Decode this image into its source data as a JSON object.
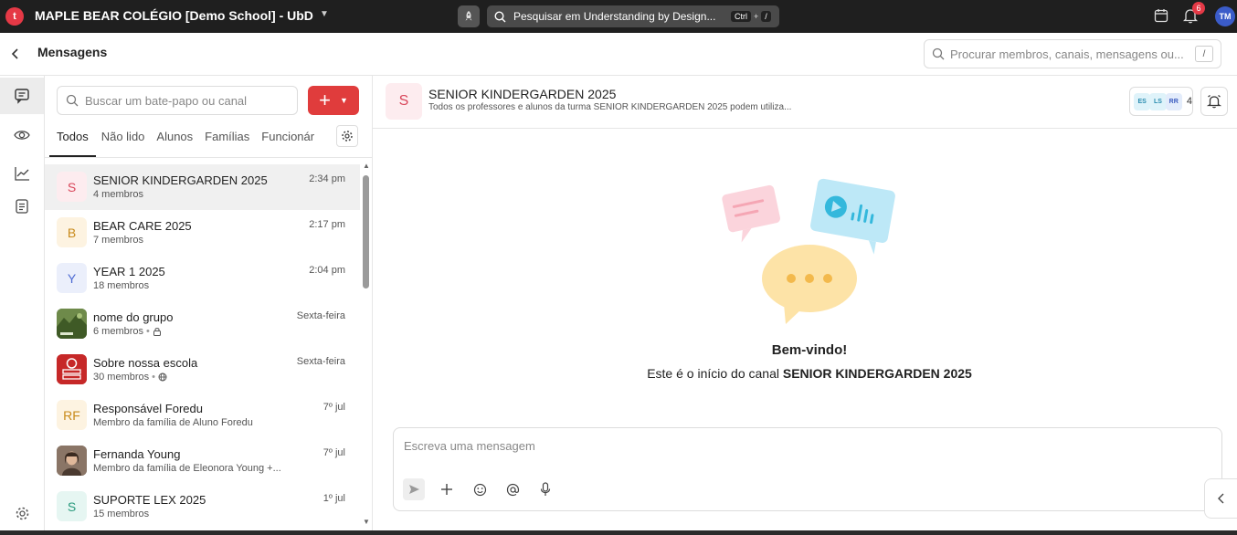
{
  "topbar": {
    "logo_letter": "t",
    "school_name": "MAPLE BEAR COLÉGIO [Demo School] - UbD",
    "search_text": "Pesquisar em Understanding by Design...",
    "shortcut_ctrl": "Ctrl",
    "shortcut_plus": "+",
    "shortcut_slash": "/",
    "notification_count": "6",
    "user_initials": "TM",
    "avatar_color": "#3b5cc9",
    "badge_color": "#e53946"
  },
  "header": {
    "title": "Mensagens",
    "search_placeholder": "Procurar membros, canais, mensagens ou...",
    "search_shortcut": "/"
  },
  "rail": {
    "icons": [
      "chat-icon",
      "eye-icon",
      "analytics-icon",
      "notes-icon",
      "settings-icon"
    ]
  },
  "list": {
    "search_placeholder": "Buscar um bate-papo ou canal",
    "new_button_color": "#e03c3c",
    "tabs": [
      "Todos",
      "Não lido",
      "Alunos",
      "Famílias",
      "Funcionár"
    ],
    "active_tab": "Todos",
    "chats": [
      {
        "initials": "S",
        "name": "SENIOR KINDERGARDEN 2025",
        "sub": "4 membros",
        "time": "2:34 pm",
        "bg": "#fdecef",
        "fg": "#d9475b"
      },
      {
        "initials": "B",
        "name": "BEAR CARE 2025",
        "sub": "7 membros",
        "time": "2:17 pm",
        "bg": "#fdf3e1",
        "fg": "#c88a1a"
      },
      {
        "initials": "Y",
        "name": "YEAR 1 2025",
        "sub": "18 membros",
        "time": "2:04 pm",
        "bg": "#ebeffb",
        "fg": "#4e6bd3"
      },
      {
        "initials": "",
        "name": "nome do grupo",
        "sub": "6 membros",
        "time": "Sexta-feira",
        "bg": "#4c6b2f",
        "fg": "#fff"
      },
      {
        "initials": "",
        "name": "Sobre nossa escola",
        "sub": "30 membros",
        "time": "Sexta-feira",
        "bg": "#c62828",
        "fg": "#fff"
      },
      {
        "initials": "RF",
        "name": "Responsável Foredu",
        "sub": "Membro da família de Aluno Foredu",
        "time": "7º jul",
        "bg": "#fdf3e1",
        "fg": "#c88a1a"
      },
      {
        "initials": "",
        "name": "Fernanda Young",
        "sub": "Membro da família de Eleonora Young +...",
        "time": "7º jul",
        "bg": "#6b5a4e",
        "fg": "#fff"
      },
      {
        "initials": "S",
        "name": "SUPORTE LEX 2025",
        "sub": "15 membros",
        "time": "1º jul",
        "bg": "#e6f6f2",
        "fg": "#2a9a7d"
      }
    ]
  },
  "channel": {
    "initial": "S",
    "name": "SENIOR KINDERGARDEN 2025",
    "description": "Todos os professores e alunos da turma SENIOR KINDERGARDEN 2025 podem utiliza...",
    "members": [
      {
        "initials": "ES",
        "bg": "#dff3fa",
        "fg": "#2a8cb0"
      },
      {
        "initials": "LS",
        "bg": "#dff3fa",
        "fg": "#2a8cb0"
      },
      {
        "initials": "RR",
        "bg": "#e3ecfb",
        "fg": "#3a5bbf"
      }
    ],
    "member_count": "4"
  },
  "welcome": {
    "title": "Bem-vindo!",
    "subtitle_prefix": "Este é o início do canal",
    "subtitle_channel": "SENIOR KINDERGARDEN 2025"
  },
  "composer": {
    "placeholder": "Escreva uma mensagem",
    "tools": [
      "send-icon",
      "plus-icon",
      "emoji-icon",
      "mention-icon",
      "microphone-icon"
    ]
  }
}
